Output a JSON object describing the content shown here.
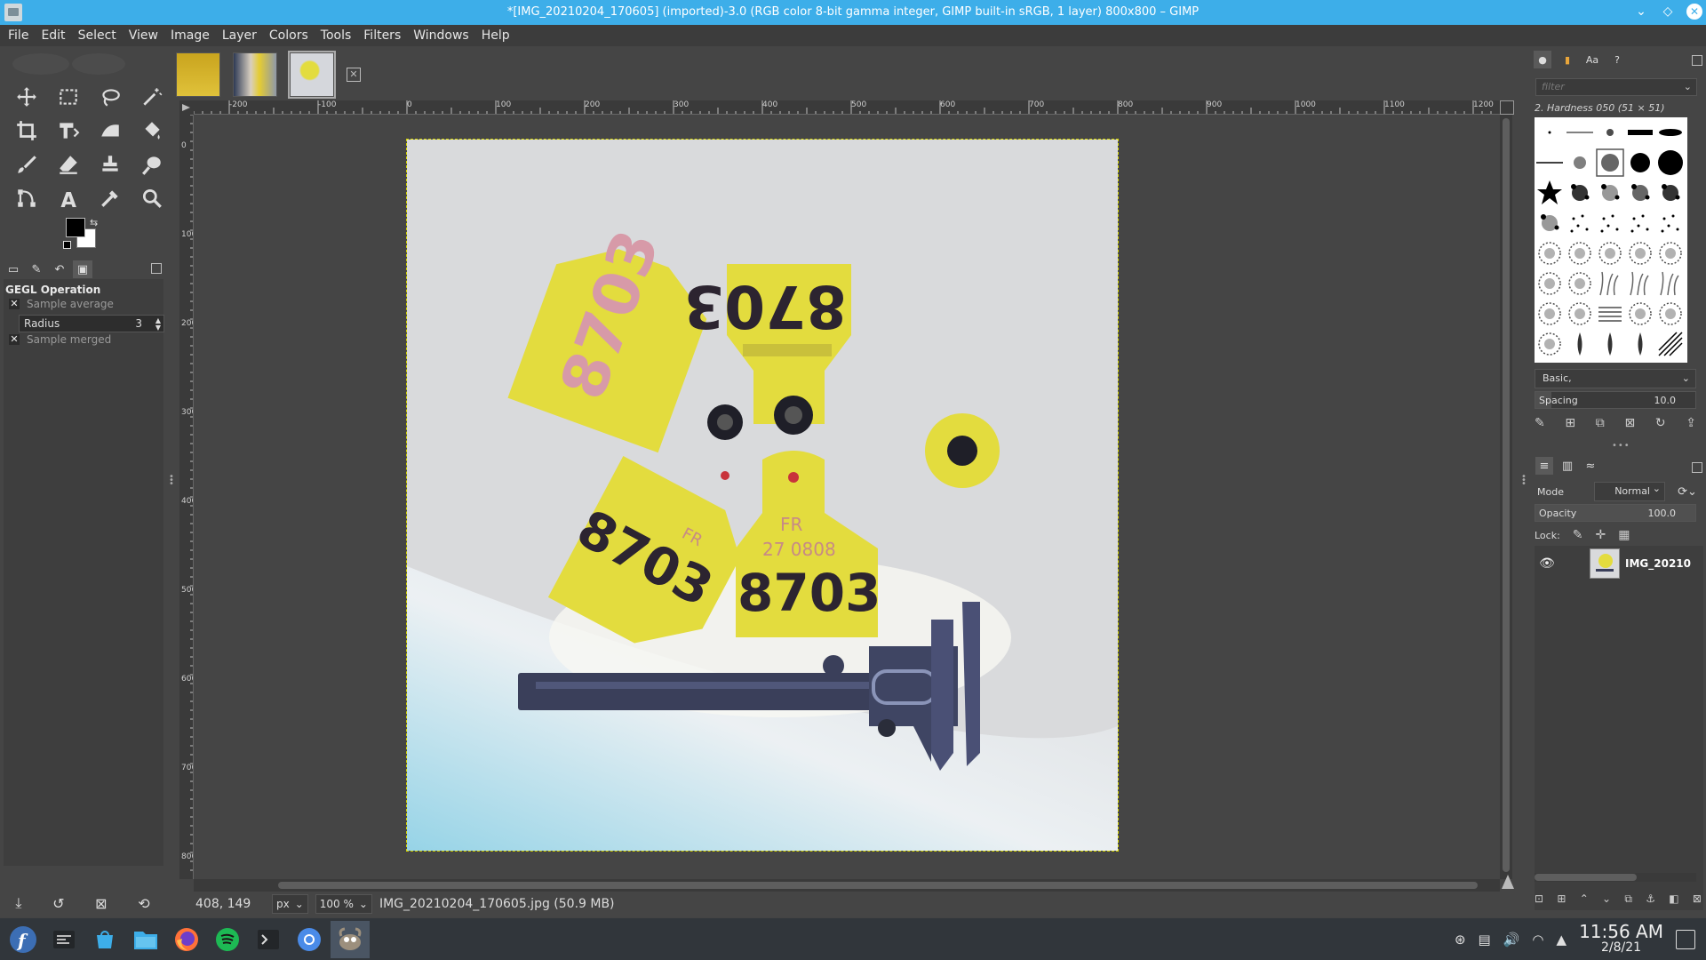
{
  "window": {
    "title": "*[IMG_20210204_170605] (imported)-3.0 (RGB color 8-bit gamma integer, GIMP built-in sRGB, 1 layer) 800x800 – GIMP",
    "buttons": [
      "minimize",
      "maximize",
      "close"
    ]
  },
  "menubar": [
    "File",
    "Edit",
    "Select",
    "View",
    "Image",
    "Layer",
    "Colors",
    "Tools",
    "Filters",
    "Windows",
    "Help"
  ],
  "tool_options": {
    "title": "GEGL Operation",
    "sample_average_label": "Sample average",
    "radius_label": "Radius",
    "radius_value": "3",
    "sample_merged_label": "Sample merged"
  },
  "rulers": {
    "top": [
      "-200",
      "-100",
      "0",
      "100",
      "200",
      "300",
      "400",
      "500",
      "600",
      "700",
      "800",
      "900",
      "1000",
      "1100",
      "1200"
    ],
    "left": [
      "0",
      "100",
      "200",
      "300",
      "400",
      "500",
      "600",
      "700",
      "800"
    ]
  },
  "statusbar": {
    "coords": "408, 149",
    "unit": "px",
    "zoom": "100 %",
    "file_info": "IMG_20210204_170605.jpg (50.9 MB)"
  },
  "brushes": {
    "filter_placeholder": "filter",
    "selected_brush": "2. Hardness 050 (51 × 51)",
    "preset": "Basic,",
    "spacing_label": "Spacing",
    "spacing_value": "10.0",
    "spacing_fraction": 0.1
  },
  "layers": {
    "mode_label": "Mode",
    "mode_value": "Normal",
    "opacity_label": "Opacity",
    "opacity_value": "100.0",
    "lock_label": "Lock:",
    "items": [
      {
        "name": "IMG_20210",
        "visible": true
      }
    ]
  },
  "image_content": {
    "tag_numbers": [
      "8703",
      "8703",
      "8703",
      "8703"
    ],
    "tag_codes": [
      "FR",
      "27 0808"
    ]
  },
  "taskbar": {
    "time": "11:56 AM",
    "date": "2/8/21"
  },
  "colors": {
    "titlebar": "#3daee9",
    "foreground": "#000000",
    "background": "#ffffff",
    "tag_yellow": "#e6df1c",
    "tag_text": "#2c2430"
  }
}
